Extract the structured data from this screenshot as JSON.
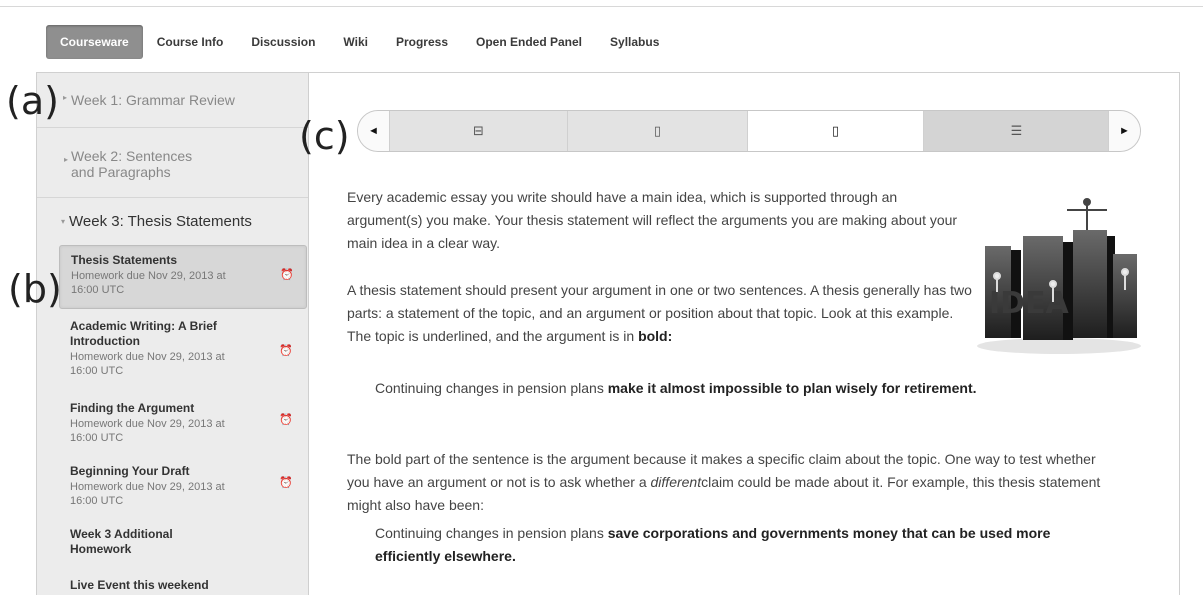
{
  "nav": {
    "tabs": [
      {
        "label": "Courseware",
        "active": true
      },
      {
        "label": "Course Info"
      },
      {
        "label": "Discussion"
      },
      {
        "label": "Wiki"
      },
      {
        "label": "Progress"
      },
      {
        "label": "Open Ended Panel"
      },
      {
        "label": "Syllabus"
      }
    ]
  },
  "sidebar": {
    "weeks": [
      {
        "label": "Week 1: Grammar Review",
        "expanded": false
      },
      {
        "label": "Week 2: Sentences and Paragraphs",
        "line1": "Week 2: Sentences",
        "line2": "and Paragraphs",
        "expanded": false
      },
      {
        "label": "Week 3: Thesis Statements",
        "expanded": true
      }
    ],
    "items": [
      {
        "title": "Thesis Statements",
        "due1": "Homework due Nov 29, 2013 at",
        "due2": "16:00 UTC",
        "active": true
      },
      {
        "title1": "Academic Writing: A Brief",
        "title2": "Introduction",
        "due1": "Homework due Nov 29, 2013 at",
        "due2": "16:00 UTC"
      },
      {
        "title": "Finding the Argument",
        "due1": "Homework due Nov 29, 2013 at",
        "due2": "16:00 UTC"
      },
      {
        "title": "Beginning Your Draft",
        "due1": "Homework due Nov 29, 2013 at",
        "due2": "16:00 UTC"
      },
      {
        "title1": "Week 3 Additional",
        "title2": "Homework"
      },
      {
        "title": "Live Event this weekend"
      }
    ]
  },
  "sequence": {
    "prev": "◄",
    "next": "►",
    "tabs": [
      {
        "icon": "video-icon",
        "glyph": "⊟"
      },
      {
        "icon": "document-icon",
        "glyph": "▯"
      },
      {
        "icon": "document-icon",
        "glyph": "▯",
        "active": true
      },
      {
        "icon": "list-icon",
        "glyph": "☰"
      }
    ]
  },
  "content": {
    "p1": "Every academic essay you write should have a main idea, which is supported through an argument(s) you make. Your thesis statement will reflect the arguments you are making about your main idea in a clear way.",
    "p2_text": "A thesis statement should present your argument in one or two sentences. A thesis generally has two parts: a statement of the topic, and an argument or position about that topic. Look at this example. The topic is underlined, and the argument is in ",
    "p2_bold": "bold:",
    "q1_plain": "Continuing changes in pension plans ",
    "q1_bold": "make it almost impossible to plan wisely for  retirement.",
    "p3_a": "The bold part of the sentence is the argument because it makes a specific claim about the topic. One way to test whether you have an argument or not is to ask whether a ",
    "p3_em": "different",
    "p3_b": "claim could be made about it. For example, this thesis statement might also have been:",
    "q2_plain": "Continuing changes in pension plans ",
    "q2_bold": "save corporations and governments money that can be used more efficiently elsewhere.",
    "image_text": "IDEA"
  },
  "annotations": {
    "a": "(a)",
    "b": "(b)",
    "c": "(c)"
  }
}
